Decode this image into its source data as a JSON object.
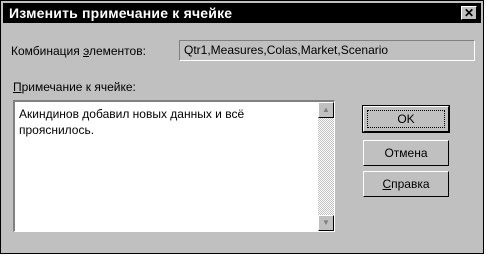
{
  "dialog": {
    "title": "Изменить примечание к ячейке",
    "close_glyph": "✕"
  },
  "combination": {
    "label_pre": "Комбинация ",
    "label_hotkey": "э",
    "label_post": "лементов:",
    "value": "Qtr1,Measures,Colas,Market,Scenario"
  },
  "note": {
    "label_hotkey": "П",
    "label_post": "римечание к ячейке:",
    "text": "Акиндинов добавил новых данных и всё прояснилось."
  },
  "scrollbar": {
    "up_icon": "▲",
    "down_icon": "▼"
  },
  "buttons": {
    "ok": "OK",
    "cancel": "Отмена",
    "help_hotkey": "С",
    "help_post": "правка"
  }
}
